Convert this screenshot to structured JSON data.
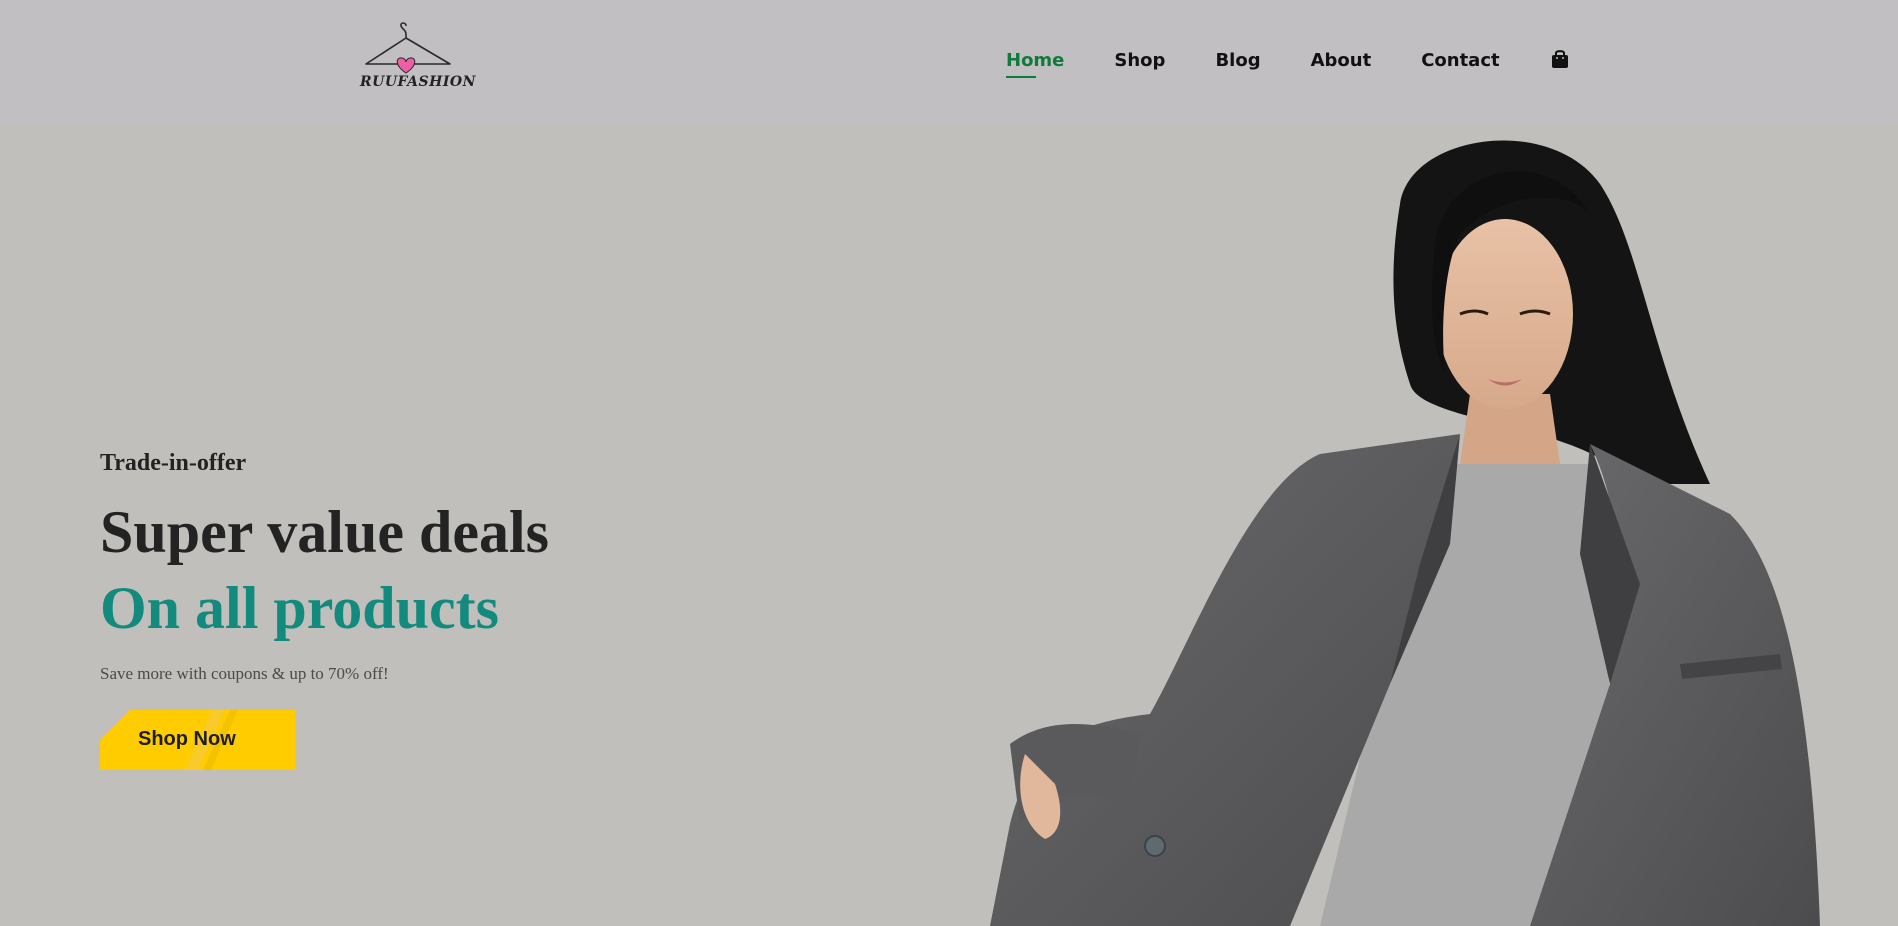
{
  "brand": {
    "logo_text": "RUUFASHION"
  },
  "nav": {
    "items": [
      {
        "label": "Home",
        "active": true
      },
      {
        "label": "Shop",
        "active": false
      },
      {
        "label": "Blog",
        "active": false
      },
      {
        "label": "About",
        "active": false
      },
      {
        "label": "Contact",
        "active": false
      }
    ],
    "cart_icon": "shopping-bag-icon"
  },
  "hero": {
    "tag": "Trade-in-offer",
    "headline_1": "Super value deals",
    "headline_2": "On all products",
    "subtext": "Save more with coupons & up to 70% off!",
    "cta_label": "Shop Now",
    "image_description_icon": "model-photo"
  },
  "colors": {
    "accent_green": "#0e7a3b",
    "teal_headline": "#128a7e",
    "button_yellow": "#ffcc00",
    "header_bg": "#c1bfc1",
    "hero_bg": "#c0bfbb"
  }
}
